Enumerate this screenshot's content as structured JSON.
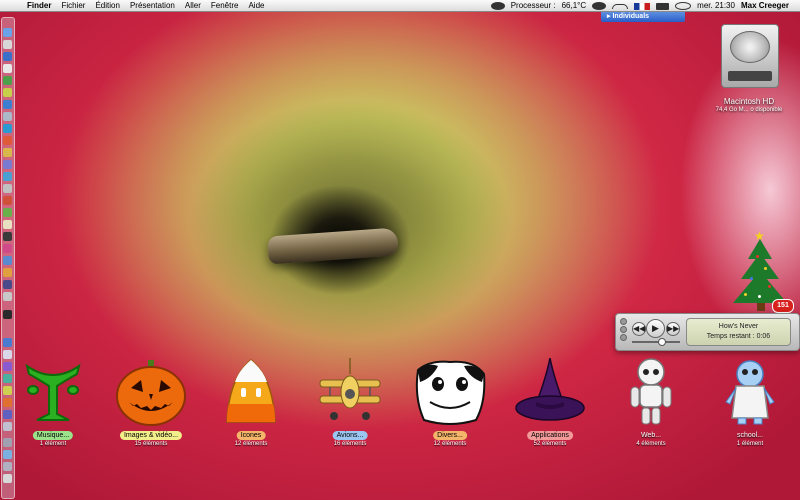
{
  "menubar": {
    "apple_icon": "apple-icon",
    "items": [
      "Finder",
      "Fichier",
      "Édition",
      "Présentation",
      "Aller",
      "Fenêtre",
      "Aide"
    ],
    "cpu_label": "Processeur :",
    "cpu_temp": "66,1°C",
    "clock": "mer. 21:30",
    "user": "Max Creeger"
  },
  "account_menu": {
    "label": "Individuals"
  },
  "hard_drive": {
    "name": "Macintosh HD",
    "info": "74,4 Go M... o disponible"
  },
  "tree_widget": {
    "badge": "151"
  },
  "itunes": {
    "track": "How's Never",
    "time": "Temps restant : 0:06",
    "volume": 0.6
  },
  "folders": [
    {
      "label": "Musique...",
      "count": "1 élément",
      "color": "#9be28a"
    },
    {
      "label": "Images & vidéo...",
      "count": "15 éléments",
      "color": "#f2ee8a"
    },
    {
      "label": "Icones",
      "count": "12 éléments",
      "color": "#f4b46a"
    },
    {
      "label": "Avions...",
      "count": "16 éléments",
      "color": "#9cc6f2"
    },
    {
      "label": "Divers...",
      "count": "12 éléments",
      "color": "#f4b46a"
    },
    {
      "label": "Applications",
      "count": "52 éléments",
      "color": "#f29a9a"
    },
    {
      "label": "Web...",
      "count": "4 éléments",
      "color": ""
    },
    {
      "label": "school...",
      "count": "1 élément",
      "color": ""
    }
  ]
}
